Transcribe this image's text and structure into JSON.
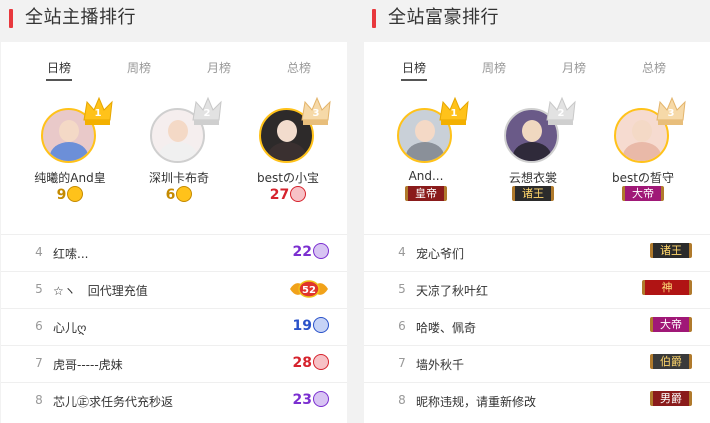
{
  "colors": {
    "accent_red": "#e8383d",
    "level_purple": "#7b2fd0",
    "level_red": "#d6232d",
    "level_blue": "#2a52c9",
    "gold": "#ffc21a"
  },
  "anchor_ranking": {
    "title": "全站主播排行",
    "tabs": [
      {
        "label": "日榜",
        "active": true
      },
      {
        "label": "周榜",
        "active": false
      },
      {
        "label": "月榜",
        "active": false
      },
      {
        "label": "总榜",
        "active": false
      }
    ],
    "top3": [
      {
        "rank": 1,
        "name": "纯曦的And皇",
        "level": "9",
        "level_icon": "crown-medal-icon"
      },
      {
        "rank": 2,
        "name": "深圳卡布奇",
        "level": "6",
        "level_icon": "crown-medal-icon"
      },
      {
        "rank": 3,
        "name": "bestの小宝",
        "level": "27",
        "level_icon": "star-medal-icon"
      }
    ],
    "list": [
      {
        "rank": "4",
        "name": "红嗦...",
        "level": "22"
      },
      {
        "rank": "5",
        "name": "☆ヽ　回代理充值",
        "level": "52"
      },
      {
        "rank": "6",
        "name": "心儿ღ",
        "level": "19"
      },
      {
        "rank": "7",
        "name": "虎哥-----虎妹",
        "level": "28"
      },
      {
        "rank": "8",
        "name": "芯儿㊣求任务代充秒返",
        "level": "23"
      }
    ]
  },
  "rich_ranking": {
    "title": "全站富豪排行",
    "tabs": [
      {
        "label": "日榜",
        "active": true
      },
      {
        "label": "周榜",
        "active": false
      },
      {
        "label": "月榜",
        "active": false
      },
      {
        "label": "总榜",
        "active": false
      }
    ],
    "top3": [
      {
        "rank": 1,
        "name": "And...",
        "badge": "皇帝"
      },
      {
        "rank": 2,
        "name": "云想衣裳",
        "badge": "诸王"
      },
      {
        "rank": 3,
        "name": "bestの晳守",
        "badge": "大帝"
      }
    ],
    "list": [
      {
        "rank": "4",
        "name": "宠心爷们",
        "badge": "诸王"
      },
      {
        "rank": "5",
        "name": "天凉了秋叶红",
        "badge": "神"
      },
      {
        "rank": "6",
        "name": "哈喽、佩奇",
        "badge": "大帝"
      },
      {
        "rank": "7",
        "name": "墙外秋千",
        "badge": "伯爵"
      },
      {
        "rank": "8",
        "name": "昵称违规，请重新修改",
        "badge": "男爵"
      }
    ]
  }
}
